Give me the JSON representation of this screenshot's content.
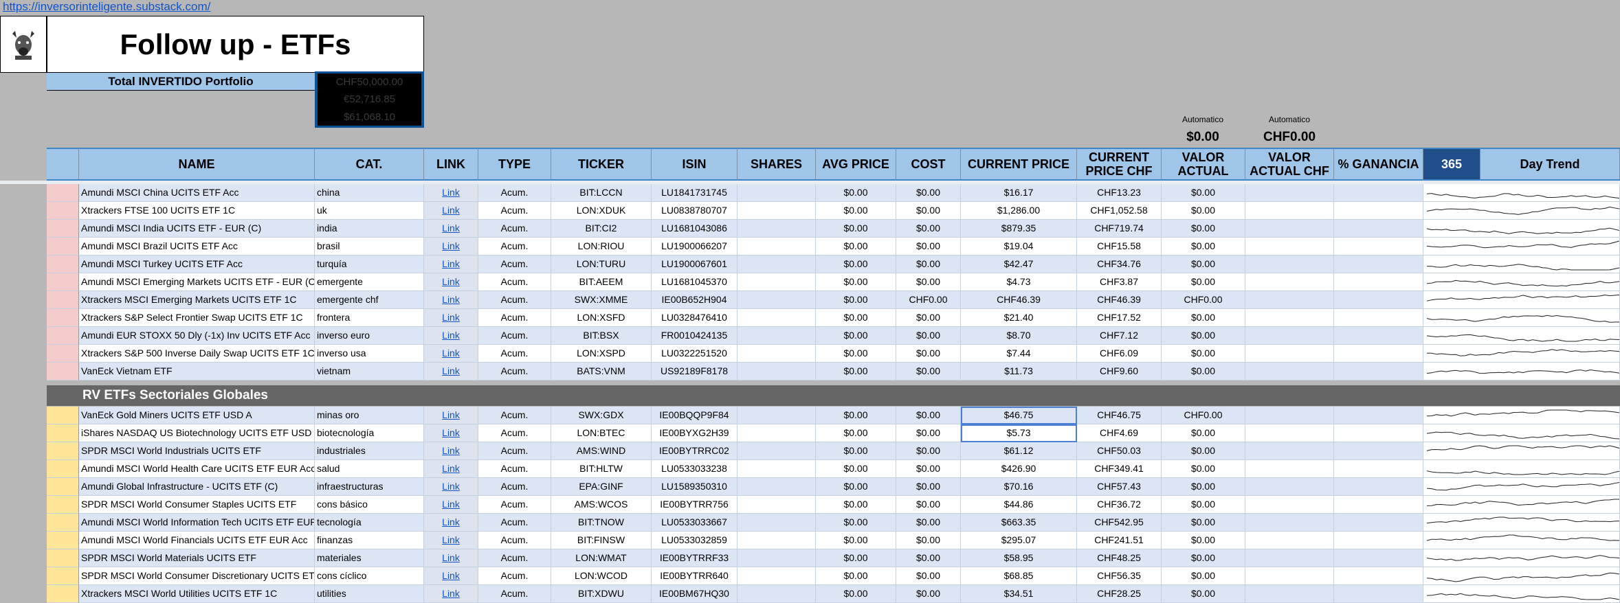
{
  "top_link": "https://inversorinteligente.substack.com/",
  "title": "Follow up - ETFs",
  "total_label": "Total INVERTIDO Portfolio",
  "totals": [
    "CHF50,000.00",
    "€52,716.85",
    "$61,068.10"
  ],
  "automatico": [
    {
      "label": "Automatico",
      "value": "$0.00"
    },
    {
      "label": "Automatico",
      "value": "CHF0.00"
    }
  ],
  "headers": {
    "name": "NAME",
    "cat": "CAT.",
    "link": "LINK",
    "type": "TYPE",
    "ticker": "TICKER",
    "isin": "ISIN",
    "shares": "SHARES",
    "avg": "AVG PRICE",
    "cost": "COST",
    "cur": "CURRENT PRICE",
    "curchf": "CURRENT PRICE CHF",
    "valor": "VALOR ACTUAL",
    "valorchf": "VALOR ACTUAL CHF",
    "gan": "% GANANCIA",
    "d365": "365",
    "trend": "Day Trend"
  },
  "colors": {
    "header_bg": "#9fc5e8",
    "group1_marker": "#f4cccc",
    "group2_marker": "#ffe599",
    "row_bg": "#dce5f4",
    "section_bg": "#666666"
  },
  "group1": [
    {
      "name": "Amundi MSCI China UCITS ETF Acc",
      "cat": "china",
      "link": "Link",
      "type": "Acum.",
      "ticker": "BIT:LCCN",
      "isin": "LU1841731745",
      "shares": "",
      "avg": "$0.00",
      "cost": "$0.00",
      "cur": "$16.17",
      "curchf": "CHF13.23",
      "valor": "$0.00",
      "valorchf": "",
      "gan": ""
    },
    {
      "name": "Xtrackers FTSE 100 UCITS ETF 1C",
      "cat": "uk",
      "link": "Link",
      "type": "Acum.",
      "ticker": "LON:XDUK",
      "isin": "LU0838780707",
      "shares": "",
      "avg": "$0.00",
      "cost": "$0.00",
      "cur": "$1,286.00",
      "curchf": "CHF1,052.58",
      "valor": "$0.00",
      "valorchf": "",
      "gan": ""
    },
    {
      "name": "Amundi MSCI India UCITS ETF - EUR (C)",
      "cat": "india",
      "link": "Link",
      "type": "Acum.",
      "ticker": "BIT:CI2",
      "isin": "LU1681043086",
      "shares": "",
      "avg": "$0.00",
      "cost": "$0.00",
      "cur": "$879.35",
      "curchf": "CHF719.74",
      "valor": "$0.00",
      "valorchf": "",
      "gan": ""
    },
    {
      "name": "Amundi MSCI Brazil UCITS ETF Acc",
      "cat": "brasil",
      "link": "Link",
      "type": "Acum.",
      "ticker": "LON:RIOU",
      "isin": "LU1900066207",
      "shares": "",
      "avg": "$0.00",
      "cost": "$0.00",
      "cur": "$19.04",
      "curchf": "CHF15.58",
      "valor": "$0.00",
      "valorchf": "",
      "gan": ""
    },
    {
      "name": "Amundi MSCI Turkey UCITS ETF Acc",
      "cat": "turquía",
      "link": "Link",
      "type": "Acum.",
      "ticker": "LON:TURU",
      "isin": "LU1900067601",
      "shares": "",
      "avg": "$0.00",
      "cost": "$0.00",
      "cur": "$42.47",
      "curchf": "CHF34.76",
      "valor": "$0.00",
      "valorchf": "",
      "gan": ""
    },
    {
      "name": "Amundi MSCI Emerging Markets UCITS ETF - EUR (C)",
      "cat": "emergente",
      "link": "Link",
      "type": "Acum.",
      "ticker": "BIT:AEEM",
      "isin": "LU1681045370",
      "shares": "",
      "avg": "$0.00",
      "cost": "$0.00",
      "cur": "$4.73",
      "curchf": "CHF3.87",
      "valor": "$0.00",
      "valorchf": "",
      "gan": ""
    },
    {
      "name": "Xtrackers MSCI Emerging Markets UCITS ETF 1C",
      "cat": "emergente chf",
      "link": "Link",
      "type": "Acum.",
      "ticker": "SWX:XMME",
      "isin": "IE00B652H904",
      "shares": "",
      "avg": "$0.00",
      "cost": "CHF0.00",
      "cur": "CHF46.39",
      "curchf": "CHF46.39",
      "valor": "CHF0.00",
      "valorchf": "",
      "gan": ""
    },
    {
      "name": "Xtrackers S&P Select Frontier Swap UCITS ETF 1C",
      "cat": "frontera",
      "link": "Link",
      "type": "Acum.",
      "ticker": "LON:XSFD",
      "isin": "LU0328476410",
      "shares": "",
      "avg": "$0.00",
      "cost": "$0.00",
      "cur": "$21.40",
      "curchf": "CHF17.52",
      "valor": "$0.00",
      "valorchf": "",
      "gan": ""
    },
    {
      "name": "Amundi EUR STOXX 50 Dly (-1x) Inv UCITS ETF Acc",
      "cat": "inverso euro",
      "link": "Link",
      "type": "Acum.",
      "ticker": "BIT:BSX",
      "isin": "FR0010424135",
      "shares": "",
      "avg": "$0.00",
      "cost": "$0.00",
      "cur": "$8.70",
      "curchf": "CHF7.12",
      "valor": "$0.00",
      "valorchf": "",
      "gan": ""
    },
    {
      "name": "Xtrackers S&P 500 Inverse Daily Swap UCITS ETF 1C",
      "cat": "inverso usa",
      "link": "Link",
      "type": "Acum.",
      "ticker": "LON:XSPD",
      "isin": "LU0322251520",
      "shares": "",
      "avg": "$0.00",
      "cost": "$0.00",
      "cur": "$7.44",
      "curchf": "CHF6.09",
      "valor": "$0.00",
      "valorchf": "",
      "gan": ""
    },
    {
      "name": "VanEck Vietnam ETF",
      "cat": "vietnam",
      "link": "Link",
      "type": "Acum.",
      "ticker": "BATS:VNM",
      "isin": "US92189F8178",
      "shares": "",
      "avg": "$0.00",
      "cost": "$0.00",
      "cur": "$11.73",
      "curchf": "CHF9.60",
      "valor": "$0.00",
      "valorchf": "",
      "gan": ""
    }
  ],
  "section_title": "RV ETFs Sectoriales Globales",
  "group2": [
    {
      "name": "VanEck Gold Miners UCITS ETF USD A",
      "cat": "minas oro",
      "link": "Link",
      "type": "Acum.",
      "ticker": "SWX:GDX",
      "isin": "IE00BQQP9F84",
      "shares": "",
      "avg": "$0.00",
      "cost": "$0.00",
      "cur": "$46.75",
      "curchf": "CHF46.75",
      "valor": "CHF0.00",
      "valorchf": "",
      "gan": ""
    },
    {
      "name": "iShares NASDAQ US Biotechnology UCITS ETF USD",
      "cat": "biotecnología",
      "link": "Link",
      "type": "Acum.",
      "ticker": "LON:BTEC",
      "isin": "IE00BYXG2H39",
      "shares": "",
      "avg": "$0.00",
      "cost": "$0.00",
      "cur": "$5.73",
      "curchf": "CHF4.69",
      "valor": "$0.00",
      "valorchf": "",
      "gan": ""
    },
    {
      "name": "SPDR MSCI World Industrials UCITS ETF",
      "cat": "industriales",
      "link": "Link",
      "type": "Acum.",
      "ticker": "AMS:WIND",
      "isin": "IE00BYTRRC02",
      "shares": "",
      "avg": "$0.00",
      "cost": "$0.00",
      "cur": "$61.12",
      "curchf": "CHF50.03",
      "valor": "$0.00",
      "valorchf": "",
      "gan": ""
    },
    {
      "name": "Amundi MSCI World Health Care UCITS ETF EUR Acc",
      "cat": "salud",
      "link": "Link",
      "type": "Acum.",
      "ticker": "BIT:HLTW",
      "isin": "LU0533033238",
      "shares": "",
      "avg": "$0.00",
      "cost": "$0.00",
      "cur": "$426.90",
      "curchf": "CHF349.41",
      "valor": "$0.00",
      "valorchf": "",
      "gan": ""
    },
    {
      "name": "Amundi Global Infrastructure - UCITS ETF (C)",
      "cat": "infraestructuras",
      "link": "Link",
      "type": "Acum.",
      "ticker": "EPA:GINF",
      "isin": "LU1589350310",
      "shares": "",
      "avg": "$0.00",
      "cost": "$0.00",
      "cur": "$70.16",
      "curchf": "CHF57.43",
      "valor": "$0.00",
      "valorchf": "",
      "gan": ""
    },
    {
      "name": "SPDR MSCI World Consumer Staples UCITS ETF",
      "cat": "cons básico",
      "link": "Link",
      "type": "Acum.",
      "ticker": "AMS:WCOS",
      "isin": "IE00BYTRR756",
      "shares": "",
      "avg": "$0.00",
      "cost": "$0.00",
      "cur": "$44.86",
      "curchf": "CHF36.72",
      "valor": "$0.00",
      "valorchf": "",
      "gan": ""
    },
    {
      "name": "Amundi MSCI World Information Tech UCITS ETF EUR",
      "cat": "tecnología",
      "link": "Link",
      "type": "Acum.",
      "ticker": "BIT:TNOW",
      "isin": "LU0533033667",
      "shares": "",
      "avg": "$0.00",
      "cost": "$0.00",
      "cur": "$663.35",
      "curchf": "CHF542.95",
      "valor": "$0.00",
      "valorchf": "",
      "gan": ""
    },
    {
      "name": "Amundi MSCI World Financials UCITS ETF EUR Acc",
      "cat": "finanzas",
      "link": "Link",
      "type": "Acum.",
      "ticker": "BIT:FINSW",
      "isin": "LU0533032859",
      "shares": "",
      "avg": "$0.00",
      "cost": "$0.00",
      "cur": "$295.07",
      "curchf": "CHF241.51",
      "valor": "$0.00",
      "valorchf": "",
      "gan": ""
    },
    {
      "name": "SPDR MSCI World Materials UCITS ETF",
      "cat": "materiales",
      "link": "Link",
      "type": "Acum.",
      "ticker": "LON:WMAT",
      "isin": "IE00BYTRRF33",
      "shares": "",
      "avg": "$0.00",
      "cost": "$0.00",
      "cur": "$58.95",
      "curchf": "CHF48.25",
      "valor": "$0.00",
      "valorchf": "",
      "gan": ""
    },
    {
      "name": "SPDR MSCI World Consumer Discretionary UCITS ETF",
      "cat": "cons cíclico",
      "link": "Link",
      "type": "Acum.",
      "ticker": "LON:WCOD",
      "isin": "IE00BYTRR640",
      "shares": "",
      "avg": "$0.00",
      "cost": "$0.00",
      "cur": "$68.85",
      "curchf": "CHF56.35",
      "valor": "$0.00",
      "valorchf": "",
      "gan": ""
    },
    {
      "name": "Xtrackers MSCI World Utilities UCITS ETF 1C",
      "cat": "utilities",
      "link": "Link",
      "type": "Acum.",
      "ticker": "BIT:XDWU",
      "isin": "IE00BM67HQ30",
      "shares": "",
      "avg": "$0.00",
      "cost": "$0.00",
      "cur": "$34.51",
      "curchf": "CHF28.25",
      "valor": "$0.00",
      "valorchf": "",
      "gan": ""
    }
  ]
}
